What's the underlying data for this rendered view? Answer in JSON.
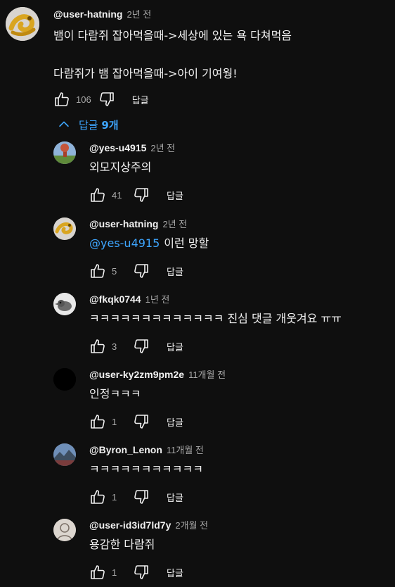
{
  "top_comment": {
    "author": "@user-hatning",
    "time": "2년 전",
    "text": "뱀이 다람쥐 잡아먹을때->세상에 있는 욕 다쳐먹음\n\n다람쥐가 뱀 잡아먹을때->아이 기여웡!",
    "likes": "106",
    "reply_label": "답글",
    "avatar_icon": "yellow-snake-avatar"
  },
  "replies_toggle": {
    "prefix": "답글 ",
    "count": "9개"
  },
  "replies": [
    {
      "author": "@yes-u4915",
      "time": "2년 전",
      "mention": "",
      "text": "외모지상주의",
      "likes": "41",
      "reply_label": "답글",
      "avatar_icon": "tree-landscape-avatar"
    },
    {
      "author": "@user-hatning",
      "time": "2년 전",
      "mention": "@yes-u4915",
      "text": "이런 망할",
      "likes": "5",
      "reply_label": "답글",
      "avatar_icon": "yellow-snake-avatar"
    },
    {
      "author": "@fkqk0744",
      "time": "1년 전",
      "mention": "",
      "text": "ㅋㅋㅋㅋㅋㅋㅋㅋㅋㅋㅋㅋㅋ 진심 댓글 개웃겨요 ㅠㅠ",
      "likes": "3",
      "reply_label": "답글",
      "avatar_icon": "bird-avatar"
    },
    {
      "author": "@user-ky2zm9pm2e",
      "time": "11개월 전",
      "mention": "",
      "text": "인정ㅋㅋㅋ",
      "likes": "1",
      "reply_label": "답글",
      "avatar_icon": "black-avatar"
    },
    {
      "author": "@Byron_Lenon",
      "time": "11개월 전",
      "mention": "",
      "text": "ㅋㅋㅋㅋㅋㅋㅋㅋㅋㅋㅋ",
      "likes": "1",
      "reply_label": "답글",
      "avatar_icon": "mountain-avatar"
    },
    {
      "author": "@user-id3id7ld7y",
      "time": "2개월 전",
      "mention": "",
      "text": "용감한 다람쥐",
      "likes": "1",
      "reply_label": "답글",
      "avatar_icon": "sketch-avatar"
    }
  ],
  "colors": {
    "background": "#0f0f0f",
    "text": "#f1f1f1",
    "secondary": "#aaaaaa",
    "link": "#3ea6ff"
  }
}
